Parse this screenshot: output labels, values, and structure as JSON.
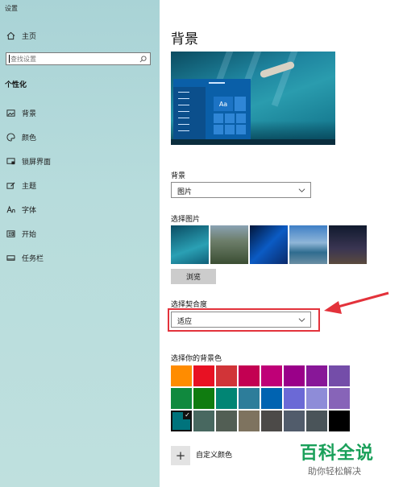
{
  "window": {
    "title": "设置"
  },
  "sidebar": {
    "home_label": "主页",
    "search_placeholder": "查找设置",
    "section_heading": "个性化",
    "items": [
      {
        "label": "背景",
        "icon": "image-icon"
      },
      {
        "label": "颜色",
        "icon": "palette-icon"
      },
      {
        "label": "锁屏界面",
        "icon": "lock-screen-icon"
      },
      {
        "label": "主题",
        "icon": "theme-brush-icon"
      },
      {
        "label": "字体",
        "icon": "font-icon"
      },
      {
        "label": "开始",
        "icon": "start-menu-icon"
      },
      {
        "label": "任务栏",
        "icon": "taskbar-icon"
      }
    ]
  },
  "main": {
    "title": "背景",
    "preview_tile_text": "Aa",
    "background_label": "背景",
    "background_value": "图片",
    "choose_picture_label": "选择图片",
    "browse_button": "浏览",
    "fit_label": "选择契合度",
    "fit_value": "适应",
    "color_label": "选择你的背景色",
    "colors": [
      "#ff8c00",
      "#e81123",
      "#d13438",
      "#c30052",
      "#bf0077",
      "#9a0089",
      "#881798",
      "#744da9",
      "#ffffff",
      "#10893e",
      "#107c10",
      "#018574",
      "#2d7d9a",
      "#0063b1",
      "#6b69d6",
      "#8e8cd8",
      "#8764b8",
      "#ffffff",
      "#00737c",
      "#486860",
      "#525e54",
      "#7e735f",
      "#4c4a48",
      "#515c6b",
      "#4a5459",
      "#000000",
      "#ffffff"
    ],
    "selected_color_index": 18,
    "custom_color_label": "自定义颜色"
  },
  "watermark": {
    "main": "百科全说",
    "sub": "助你轻松解决"
  }
}
